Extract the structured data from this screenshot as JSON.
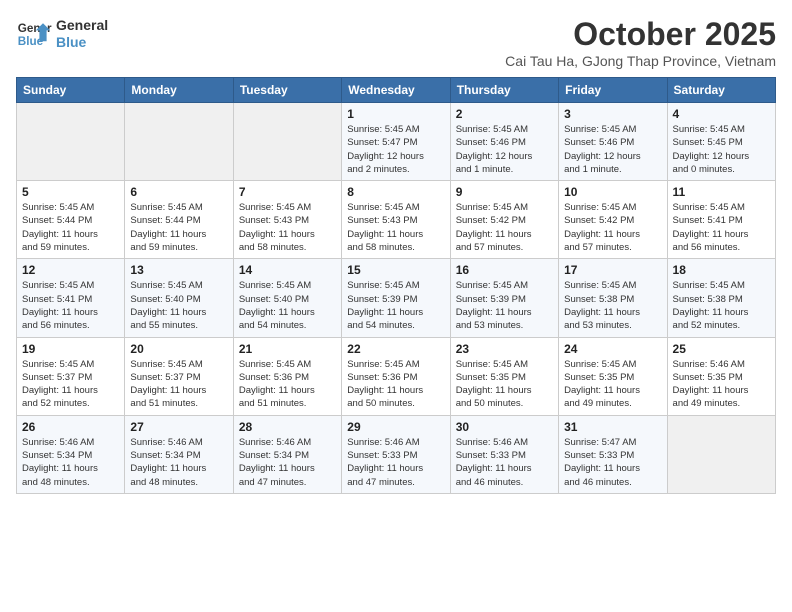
{
  "header": {
    "logo_line1": "General",
    "logo_line2": "Blue",
    "month": "October 2025",
    "location": "Cai Tau Ha, GJong Thap Province, Vietnam"
  },
  "weekdays": [
    "Sunday",
    "Monday",
    "Tuesday",
    "Wednesday",
    "Thursday",
    "Friday",
    "Saturday"
  ],
  "weeks": [
    [
      {
        "day": "",
        "info": ""
      },
      {
        "day": "",
        "info": ""
      },
      {
        "day": "",
        "info": ""
      },
      {
        "day": "1",
        "info": "Sunrise: 5:45 AM\nSunset: 5:47 PM\nDaylight: 12 hours\nand 2 minutes."
      },
      {
        "day": "2",
        "info": "Sunrise: 5:45 AM\nSunset: 5:46 PM\nDaylight: 12 hours\nand 1 minute."
      },
      {
        "day": "3",
        "info": "Sunrise: 5:45 AM\nSunset: 5:46 PM\nDaylight: 12 hours\nand 1 minute."
      },
      {
        "day": "4",
        "info": "Sunrise: 5:45 AM\nSunset: 5:45 PM\nDaylight: 12 hours\nand 0 minutes."
      }
    ],
    [
      {
        "day": "5",
        "info": "Sunrise: 5:45 AM\nSunset: 5:44 PM\nDaylight: 11 hours\nand 59 minutes."
      },
      {
        "day": "6",
        "info": "Sunrise: 5:45 AM\nSunset: 5:44 PM\nDaylight: 11 hours\nand 59 minutes."
      },
      {
        "day": "7",
        "info": "Sunrise: 5:45 AM\nSunset: 5:43 PM\nDaylight: 11 hours\nand 58 minutes."
      },
      {
        "day": "8",
        "info": "Sunrise: 5:45 AM\nSunset: 5:43 PM\nDaylight: 11 hours\nand 58 minutes."
      },
      {
        "day": "9",
        "info": "Sunrise: 5:45 AM\nSunset: 5:42 PM\nDaylight: 11 hours\nand 57 minutes."
      },
      {
        "day": "10",
        "info": "Sunrise: 5:45 AM\nSunset: 5:42 PM\nDaylight: 11 hours\nand 57 minutes."
      },
      {
        "day": "11",
        "info": "Sunrise: 5:45 AM\nSunset: 5:41 PM\nDaylight: 11 hours\nand 56 minutes."
      }
    ],
    [
      {
        "day": "12",
        "info": "Sunrise: 5:45 AM\nSunset: 5:41 PM\nDaylight: 11 hours\nand 56 minutes."
      },
      {
        "day": "13",
        "info": "Sunrise: 5:45 AM\nSunset: 5:40 PM\nDaylight: 11 hours\nand 55 minutes."
      },
      {
        "day": "14",
        "info": "Sunrise: 5:45 AM\nSunset: 5:40 PM\nDaylight: 11 hours\nand 54 minutes."
      },
      {
        "day": "15",
        "info": "Sunrise: 5:45 AM\nSunset: 5:39 PM\nDaylight: 11 hours\nand 54 minutes."
      },
      {
        "day": "16",
        "info": "Sunrise: 5:45 AM\nSunset: 5:39 PM\nDaylight: 11 hours\nand 53 minutes."
      },
      {
        "day": "17",
        "info": "Sunrise: 5:45 AM\nSunset: 5:38 PM\nDaylight: 11 hours\nand 53 minutes."
      },
      {
        "day": "18",
        "info": "Sunrise: 5:45 AM\nSunset: 5:38 PM\nDaylight: 11 hours\nand 52 minutes."
      }
    ],
    [
      {
        "day": "19",
        "info": "Sunrise: 5:45 AM\nSunset: 5:37 PM\nDaylight: 11 hours\nand 52 minutes."
      },
      {
        "day": "20",
        "info": "Sunrise: 5:45 AM\nSunset: 5:37 PM\nDaylight: 11 hours\nand 51 minutes."
      },
      {
        "day": "21",
        "info": "Sunrise: 5:45 AM\nSunset: 5:36 PM\nDaylight: 11 hours\nand 51 minutes."
      },
      {
        "day": "22",
        "info": "Sunrise: 5:45 AM\nSunset: 5:36 PM\nDaylight: 11 hours\nand 50 minutes."
      },
      {
        "day": "23",
        "info": "Sunrise: 5:45 AM\nSunset: 5:35 PM\nDaylight: 11 hours\nand 50 minutes."
      },
      {
        "day": "24",
        "info": "Sunrise: 5:45 AM\nSunset: 5:35 PM\nDaylight: 11 hours\nand 49 minutes."
      },
      {
        "day": "25",
        "info": "Sunrise: 5:46 AM\nSunset: 5:35 PM\nDaylight: 11 hours\nand 49 minutes."
      }
    ],
    [
      {
        "day": "26",
        "info": "Sunrise: 5:46 AM\nSunset: 5:34 PM\nDaylight: 11 hours\nand 48 minutes."
      },
      {
        "day": "27",
        "info": "Sunrise: 5:46 AM\nSunset: 5:34 PM\nDaylight: 11 hours\nand 48 minutes."
      },
      {
        "day": "28",
        "info": "Sunrise: 5:46 AM\nSunset: 5:34 PM\nDaylight: 11 hours\nand 47 minutes."
      },
      {
        "day": "29",
        "info": "Sunrise: 5:46 AM\nSunset: 5:33 PM\nDaylight: 11 hours\nand 47 minutes."
      },
      {
        "day": "30",
        "info": "Sunrise: 5:46 AM\nSunset: 5:33 PM\nDaylight: 11 hours\nand 46 minutes."
      },
      {
        "day": "31",
        "info": "Sunrise: 5:47 AM\nSunset: 5:33 PM\nDaylight: 11 hours\nand 46 minutes."
      },
      {
        "day": "",
        "info": ""
      }
    ]
  ]
}
